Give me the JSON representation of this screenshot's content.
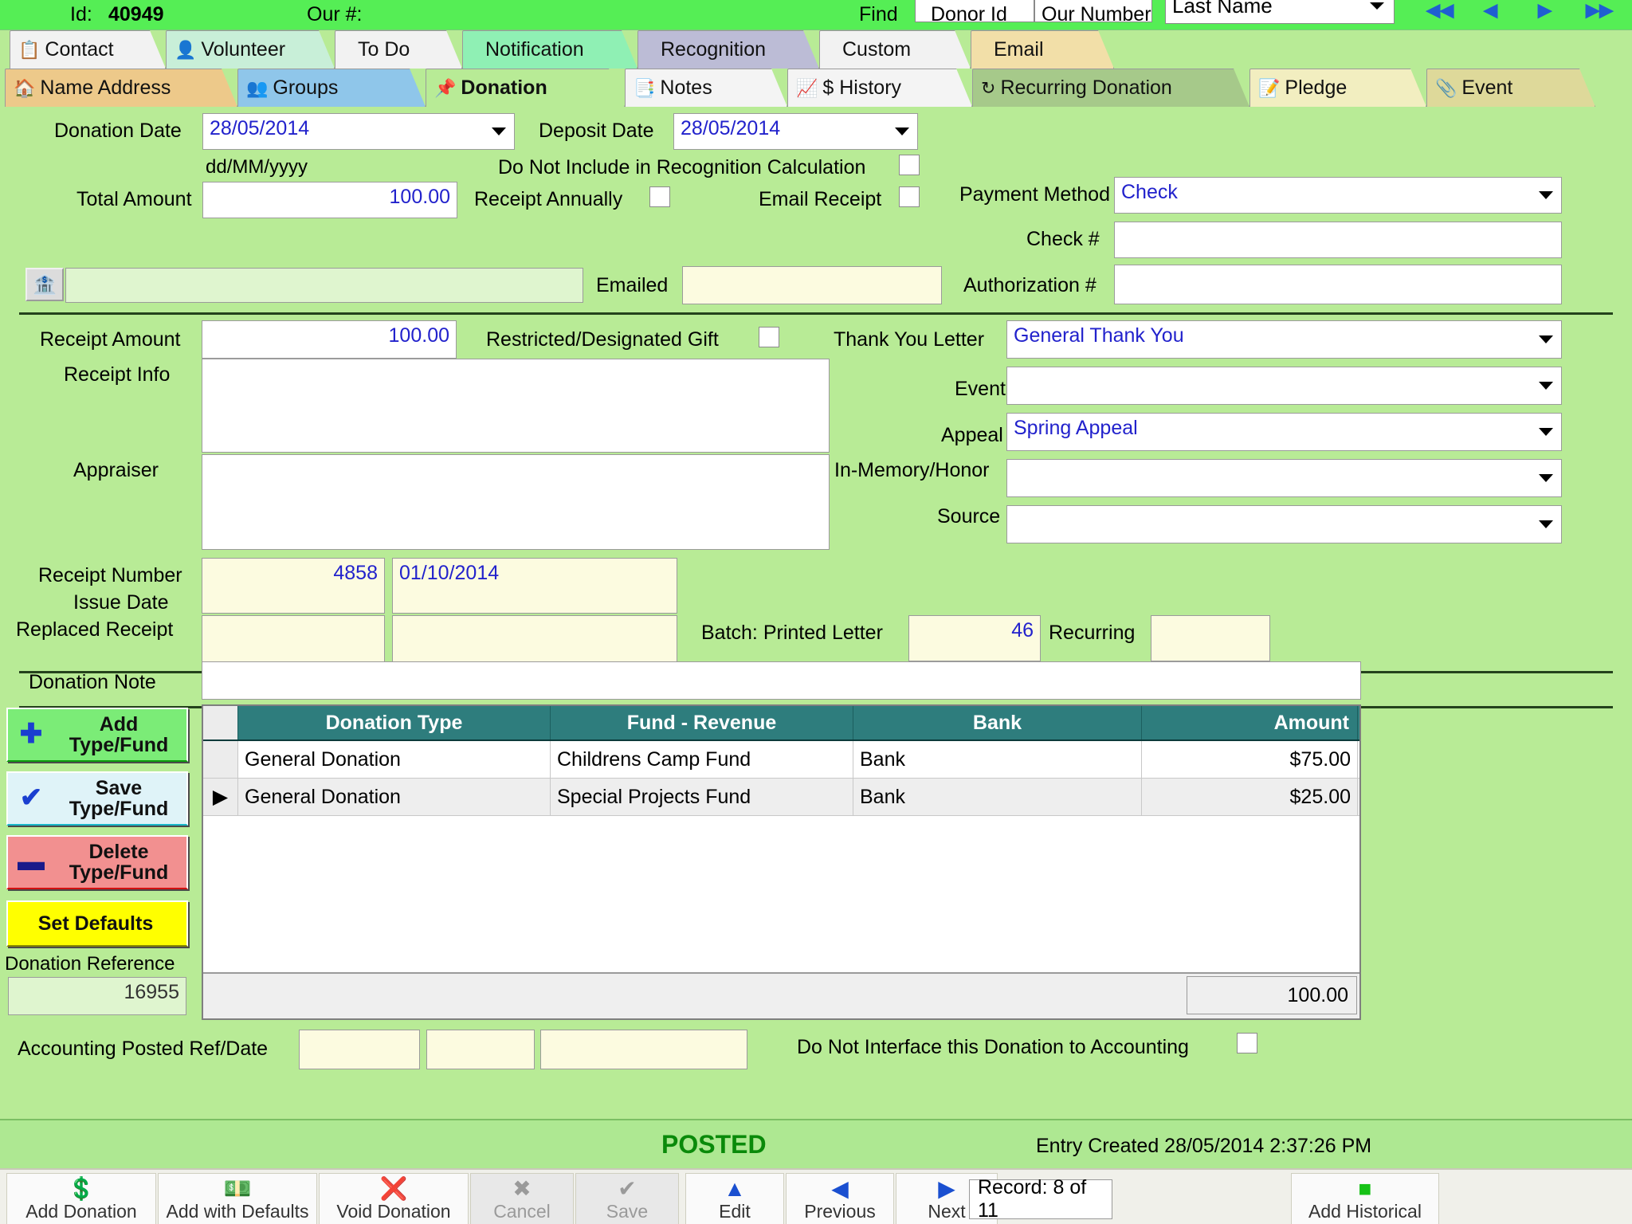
{
  "topbar": {
    "id_label": "Id:",
    "id_value": "40949",
    "our_number_label": "Our #:",
    "our_number_value": "",
    "find_label": "Find",
    "donor_id_label": "Donor Id",
    "our_number_col_label": "Our Number",
    "donor_id_value": "",
    "our_number_field_value": "",
    "search_by": "Last Name",
    "nav_icons": [
      "first-record",
      "previous-record",
      "next-record",
      "last-record"
    ]
  },
  "tabs_row1": [
    {
      "label": "Contact",
      "icon": "clipboard-icon",
      "color": "#f2f2f2",
      "active": false
    },
    {
      "label": "Volunteer",
      "icon": "person-icon",
      "color": "#c8efd8",
      "active": false
    },
    {
      "label": "To Do",
      "icon": "",
      "color": "#f2f2f2",
      "active": false
    },
    {
      "label": "Notification",
      "icon": "",
      "color": "#8ff0b4",
      "active": false
    },
    {
      "label": "Recognition",
      "icon": "",
      "color": "#bcbcd6",
      "active": false
    },
    {
      "label": "Custom",
      "icon": "",
      "color": "#f2f2f2",
      "active": false
    },
    {
      "label": "Email",
      "icon": "",
      "color": "#f2dfa8",
      "active": false
    }
  ],
  "tabs_row2": [
    {
      "label": "Name Address",
      "icon": "home-icon",
      "color": "#edc98a",
      "active": false
    },
    {
      "label": "Groups",
      "icon": "people-icon",
      "color": "#8fc6ea",
      "active": false
    },
    {
      "label": "Donation",
      "icon": "pushpin-icon",
      "color": "#b8eb96",
      "active": true
    },
    {
      "label": "Notes",
      "icon": "notes-check-icon",
      "color": "#f4f4f4",
      "active": false
    },
    {
      "label": "$ History",
      "icon": "chart-icon",
      "color": "#f4f4f4",
      "active": false
    },
    {
      "label": "Recurring Donation",
      "icon": "recycle-icon",
      "color": "#a6c98a",
      "active": false
    },
    {
      "label": "Pledge",
      "icon": "pledge-icon",
      "color": "#f2eec0",
      "active": false
    },
    {
      "label": "Event",
      "icon": "paperclip-icon",
      "color": "#ded99a",
      "active": false
    }
  ],
  "form": {
    "donation_date_label": "Donation Date",
    "donation_date_value": "28/05/2014",
    "deposit_date_label": "Deposit Date",
    "deposit_date_value": "28/05/2014",
    "date_format_hint": "dd/MM/yyyy",
    "total_amount_label": "Total Amount",
    "total_amount_value": "100.00",
    "do_not_include_label": "Do Not Include in Recognition Calculation",
    "receipt_annually_label": "Receipt Annually",
    "email_receipt_label": "Email Receipt",
    "payment_method_label": "Payment Method",
    "payment_method_value": "Check",
    "check_number_label": "Check #",
    "check_number_value": "",
    "authorization_label": "Authorization #",
    "authorization_value": "",
    "bank_icon": "bank-icon",
    "bank_field_value": "",
    "emailed_label": "Emailed",
    "emailed_value": "",
    "receipt_amount_label": "Receipt Amount",
    "receipt_amount_value": "100.00",
    "restricted_gift_label": "Restricted/Designated Gift",
    "receipt_info_label": "Receipt Info",
    "receipt_info_value": "",
    "appraiser_label": "Appraiser",
    "appraiser_value": "",
    "thank_you_label": "Thank You Letter",
    "thank_you_value": "General Thank You",
    "event_label": "Event",
    "event_value": "",
    "appeal_label": "Appeal",
    "appeal_value": "Spring Appeal",
    "in_memory_label": "In-Memory/Honor",
    "in_memory_value": "",
    "source_label": "Source",
    "source_value": "",
    "receipt_number_label": "Receipt Number",
    "receipt_number_value": "4858",
    "issue_date_label": "Issue Date",
    "issue_date_value": "01/10/2014",
    "replaced_receipt_label": "Replaced Receipt",
    "replaced_receipt_value": "",
    "replaced_receipt_date_value": "",
    "batch_label": "Batch: Printed Letter",
    "batch_value": "46",
    "recurring_label": "Recurring",
    "recurring_value": "",
    "donation_note_label": "Donation Note",
    "donation_note_value": "",
    "accounting_posted_label": "Accounting Posted Ref/Date",
    "accounting_ref_value": "",
    "accounting_date_value": "",
    "accounting_extra_value": "",
    "do_not_interface_label": "Do Not Interface this Donation to Accounting"
  },
  "side_buttons": [
    {
      "label_line1": "Add",
      "label_line2": "Type/Fund",
      "icon": "plus-icon",
      "color": "#7bec77"
    },
    {
      "label_line1": "Save",
      "label_line2": "Type/Fund",
      "icon": "check-icon",
      "color": "#dff3f8"
    },
    {
      "label_line1": "Delete",
      "label_line2": "Type/Fund",
      "icon": "minus-icon",
      "color": "#f29090"
    }
  ],
  "set_defaults_label": "Set Defaults",
  "donation_reference_label": "Donation Reference",
  "donation_reference_value": "16955",
  "grid": {
    "columns": [
      "",
      "Donation Type",
      "Fund - Revenue",
      "Bank",
      "Amount"
    ],
    "rows": [
      {
        "selector": "",
        "type": "General Donation",
        "fund": "Childrens Camp Fund",
        "bank": "Bank",
        "amount": "$75.00"
      },
      {
        "selector": "▶",
        "type": "General Donation",
        "fund": "Special Projects Fund",
        "bank": "Bank",
        "amount": "$25.00"
      }
    ],
    "total": "100.00"
  },
  "status": {
    "posted_label": "POSTED",
    "entry_created": "Entry Created  28/05/2014 2:37:26 PM"
  },
  "toolbar": [
    {
      "label": "Add Donation",
      "icon": "green-money-icon",
      "disabled": false
    },
    {
      "label": "Add with Defaults",
      "icon": "yellow-money-icon",
      "disabled": false
    },
    {
      "label": "Void Donation",
      "icon": "void-money-icon",
      "disabled": false
    },
    {
      "label": "Cancel",
      "icon": "x-icon",
      "disabled": true
    },
    {
      "label": "Save",
      "icon": "check-icon",
      "disabled": true
    },
    {
      "label": "Edit",
      "icon": "up-triangle-icon",
      "disabled": false
    },
    {
      "label": "Previous",
      "icon": "left-arrow-icon",
      "disabled": false
    },
    {
      "label": "Next",
      "icon": "right-arrow-icon",
      "disabled": false
    }
  ],
  "record_counter": "Record: 8 of 11",
  "add_historical": {
    "label": "Add Historical",
    "icon": "green-box-icon"
  },
  "colors": {
    "form_bg": "#b8eb96",
    "topbar_bg": "#55ee55",
    "grid_header": "#2e7d7d",
    "posted_text": "#0a8a0a",
    "value_text": "#2222cc"
  }
}
